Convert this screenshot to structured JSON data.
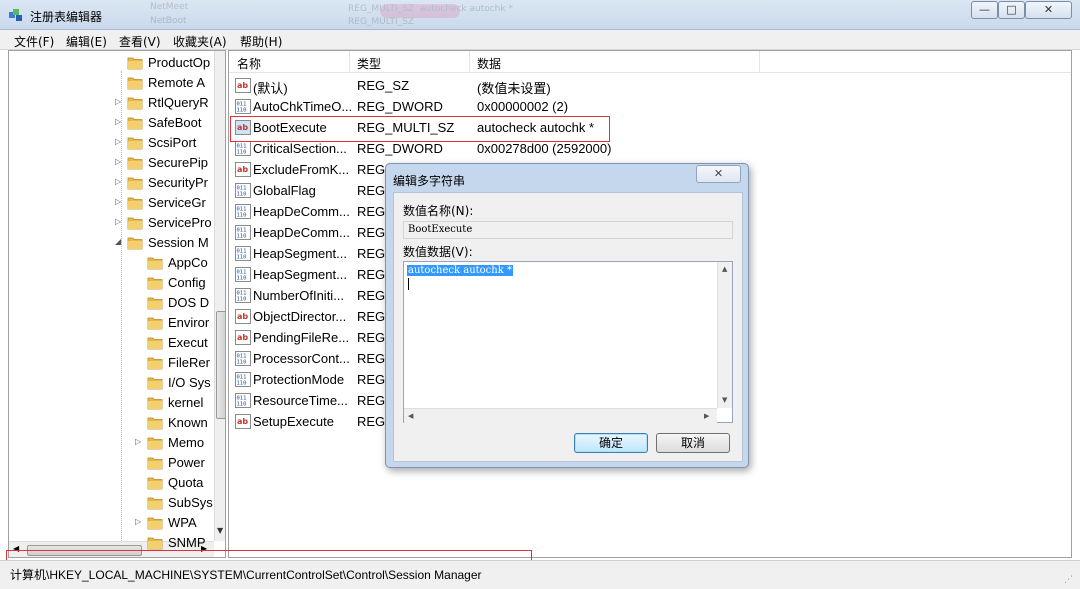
{
  "window": {
    "title": "注册表编辑器",
    "controls": {
      "minimize": "—",
      "maximize": "□",
      "close": "✕"
    },
    "background_tabs": [
      "NetMeet",
      "NetBoot",
      "REG_MULTI_SZ",
      "autocheck autochk *",
      "REG_MULTI_SZ"
    ]
  },
  "menu": {
    "items": [
      "文件(F)",
      "编辑(E)",
      "查看(V)",
      "收藏夹(A)",
      "帮助(H)"
    ]
  },
  "tree": {
    "items": [
      {
        "label": "ProductOp",
        "arrow": ""
      },
      {
        "label": "Remote A",
        "arrow": ""
      },
      {
        "label": "RtlQueryR",
        "arrow": "▷"
      },
      {
        "label": "SafeBoot",
        "arrow": "▷"
      },
      {
        "label": "ScsiPort",
        "arrow": "▷"
      },
      {
        "label": "SecurePip",
        "arrow": "▷"
      },
      {
        "label": "SecurityPr",
        "arrow": "▷"
      },
      {
        "label": "ServiceGr",
        "arrow": "▷"
      },
      {
        "label": "ServicePro",
        "arrow": "▷"
      },
      {
        "label": "Session M",
        "arrow": "◢"
      },
      {
        "label": "AppCo",
        "arrow": ""
      },
      {
        "label": "Config",
        "arrow": ""
      },
      {
        "label": "DOS D",
        "arrow": ""
      },
      {
        "label": "Enviror",
        "arrow": ""
      },
      {
        "label": "Execut",
        "arrow": ""
      },
      {
        "label": "FileRer",
        "arrow": ""
      },
      {
        "label": "I/O Sys",
        "arrow": ""
      },
      {
        "label": "kernel",
        "arrow": ""
      },
      {
        "label": "Known",
        "arrow": ""
      },
      {
        "label": "Memo",
        "arrow": "▷"
      },
      {
        "label": "Power",
        "arrow": ""
      },
      {
        "label": "Quota",
        "arrow": ""
      },
      {
        "label": "SubSys",
        "arrow": ""
      },
      {
        "label": "WPA",
        "arrow": "▷"
      },
      {
        "label": "SNMP",
        "arrow": ""
      }
    ]
  },
  "list": {
    "columns": [
      "名称",
      "类型",
      "数据"
    ],
    "rows": [
      {
        "icon": "ab",
        "name": "(默认)",
        "type": "REG_SZ",
        "data": "(数值未设置)"
      },
      {
        "icon": "bin",
        "name": "AutoChkTimeO...",
        "type": "REG_DWORD",
        "data": "0x00000002 (2)"
      },
      {
        "icon": "ab",
        "name": "BootExecute",
        "type": "REG_MULTI_SZ",
        "data": "autocheck autochk *",
        "selected": true
      },
      {
        "icon": "bin",
        "name": "CriticalSection...",
        "type": "REG_DWORD",
        "data": "0x00278d00 (2592000)"
      },
      {
        "icon": "ab",
        "name": "ExcludeFromK...",
        "type": "REG_",
        "data": ""
      },
      {
        "icon": "bin",
        "name": "GlobalFlag",
        "type": "REG_",
        "data": ""
      },
      {
        "icon": "bin",
        "name": "HeapDeComm...",
        "type": "REG_",
        "data": ""
      },
      {
        "icon": "bin",
        "name": "HeapDeComm...",
        "type": "REG_",
        "data": ""
      },
      {
        "icon": "bin",
        "name": "HeapSegment...",
        "type": "REG_",
        "data": ""
      },
      {
        "icon": "bin",
        "name": "HeapSegment...",
        "type": "REG_",
        "data": ""
      },
      {
        "icon": "bin",
        "name": "NumberOfIniti...",
        "type": "REG_",
        "data": ""
      },
      {
        "icon": "ab",
        "name": "ObjectDirector...",
        "type": "REG_",
        "data": ""
      },
      {
        "icon": "ab",
        "name": "PendingFileRe...",
        "type": "REG_",
        "data": ""
      },
      {
        "icon": "bin",
        "name": "ProcessorCont...",
        "type": "REG_",
        "data": ""
      },
      {
        "icon": "bin",
        "name": "ProtectionMode",
        "type": "REG_",
        "data": ""
      },
      {
        "icon": "bin",
        "name": "ResourceTime...",
        "type": "REG_",
        "data": ""
      },
      {
        "icon": "ab",
        "name": "SetupExecute",
        "type": "REG_",
        "data": ""
      }
    ]
  },
  "dialog": {
    "title": "编辑多字符串",
    "close": "✕",
    "name_label": "数值名称(N):",
    "name_value": "BootExecute",
    "data_label": "数值数据(V):",
    "data_value": "autocheck autochk *",
    "ok": "确定",
    "cancel": "取消"
  },
  "status": {
    "path": "计算机\\HKEY_LOCAL_MACHINE\\SYSTEM\\CurrentControlSet\\Control\\Session Manager"
  },
  "colors": {
    "highlight_box": "#e0303a",
    "selection": "#3399ff",
    "folder": "#e8b94a"
  }
}
